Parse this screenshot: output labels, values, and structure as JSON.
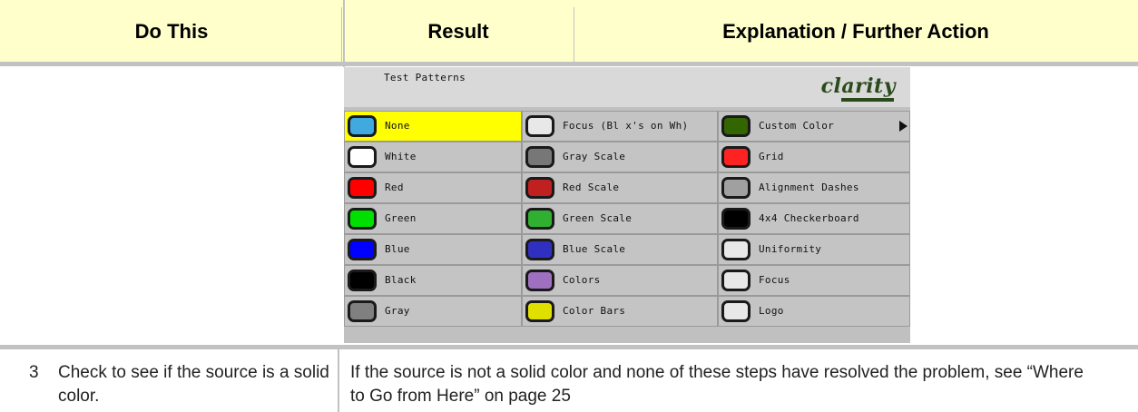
{
  "header": {
    "col1": "Do This",
    "col2": "Result",
    "col3": "Explanation / Further Action"
  },
  "screen": {
    "title": "Test Patterns",
    "logo": "clarity",
    "columns": [
      {
        "items": [
          {
            "label": "None",
            "icon": "none-pattern-icon",
            "color": "#3fa9e0",
            "selected": true
          },
          {
            "label": "White",
            "icon": "white-pattern-icon",
            "color": "#ffffff"
          },
          {
            "label": "Red",
            "icon": "red-pattern-icon",
            "color": "#ff0000"
          },
          {
            "label": "Green",
            "icon": "green-pattern-icon",
            "color": "#00e000"
          },
          {
            "label": "Blue",
            "icon": "blue-pattern-icon",
            "color": "#0000ff"
          },
          {
            "label": "Black",
            "icon": "black-pattern-icon",
            "color": "#000000"
          },
          {
            "label": "Gray",
            "icon": "gray-pattern-icon",
            "color": "#808080"
          }
        ]
      },
      {
        "items": [
          {
            "label": "Focus (Bl x's on Wh)",
            "icon": "focus-bl-on-wh-icon",
            "color": "#e8e8e8"
          },
          {
            "label": "Gray Scale",
            "icon": "gray-scale-icon",
            "color": "#777777"
          },
          {
            "label": "Red Scale",
            "icon": "red-scale-icon",
            "color": "#c02020"
          },
          {
            "label": "Green Scale",
            "icon": "green-scale-icon",
            "color": "#30b030"
          },
          {
            "label": "Blue Scale",
            "icon": "blue-scale-icon",
            "color": "#3030c0"
          },
          {
            "label": "Colors",
            "icon": "colors-icon",
            "color": "#a070c0"
          },
          {
            "label": "Color Bars",
            "icon": "color-bars-icon",
            "color": "#e0e000"
          }
        ]
      },
      {
        "items": [
          {
            "label": "Custom Color",
            "icon": "custom-color-icon",
            "color": "#336600",
            "submenu": true
          },
          {
            "label": "Grid",
            "icon": "grid-icon",
            "color": "#ff2222"
          },
          {
            "label": "Alignment Dashes",
            "icon": "alignment-dashes-icon",
            "color": "#a0a0a0"
          },
          {
            "label": "4x4 Checkerboard",
            "icon": "checkerboard-icon",
            "color": "#000000"
          },
          {
            "label": "Uniformity",
            "icon": "uniformity-icon",
            "color": "#e8e8e8"
          },
          {
            "label": "Focus",
            "icon": "focus-icon",
            "color": "#e8e8e8"
          },
          {
            "label": "Logo",
            "icon": "logo-pattern-icon",
            "color": "#e8e8e8"
          }
        ]
      }
    ]
  },
  "step": {
    "number": "3",
    "text": "Check to see if the source is a solid color.",
    "explanation": "If the source is not a solid color and none of these steps have resolved the problem, see “Where to Go from Here” on page 25"
  }
}
